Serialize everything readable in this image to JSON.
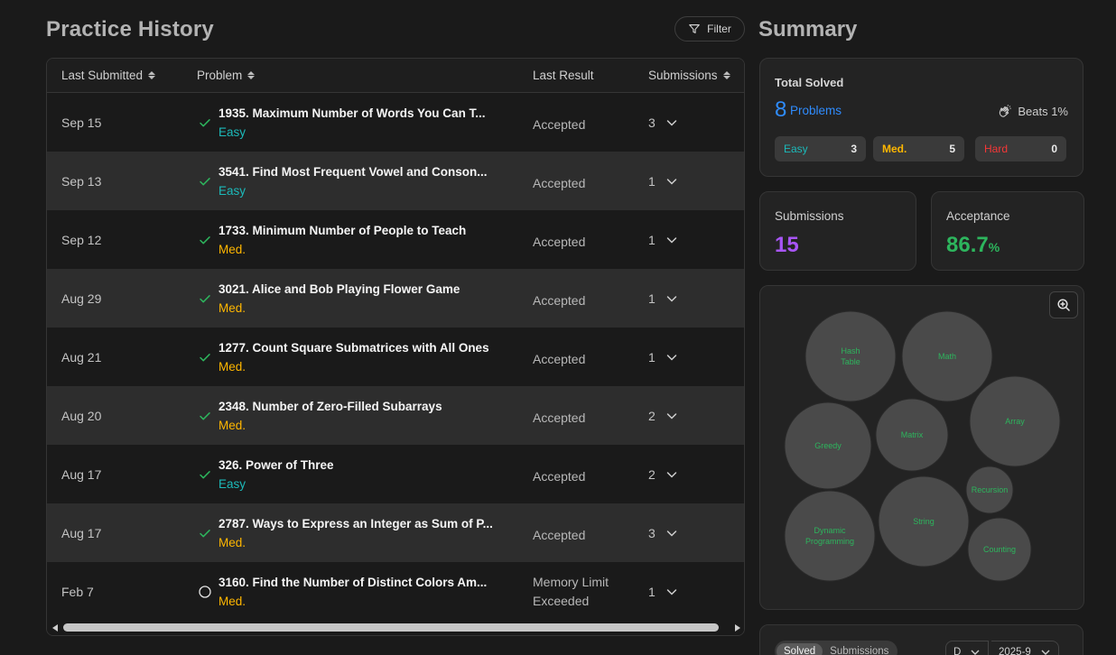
{
  "left": {
    "title": "Practice History",
    "filter_label": "Filter",
    "columns": {
      "c1": "Last Submitted",
      "c2": "Problem",
      "c3": "Last Result",
      "c4": "Submissions"
    },
    "rows": [
      {
        "date": "Sep 15",
        "name": "1935. Maximum Number of Words You Can T...",
        "difficulty": "Easy",
        "diff_class": "easy",
        "status": "check",
        "result": "Accepted",
        "subs": "3"
      },
      {
        "date": "Sep 13",
        "name": "3541. Find Most Frequent Vowel and Conson...",
        "difficulty": "Easy",
        "diff_class": "easy",
        "status": "check",
        "result": "Accepted",
        "subs": "1"
      },
      {
        "date": "Sep 12",
        "name": "1733. Minimum Number of People to Teach",
        "difficulty": "Med.",
        "diff_class": "med",
        "status": "check",
        "result": "Accepted",
        "subs": "1"
      },
      {
        "date": "Aug 29",
        "name": "3021. Alice and Bob Playing Flower Game",
        "difficulty": "Med.",
        "diff_class": "med",
        "status": "check",
        "result": "Accepted",
        "subs": "1"
      },
      {
        "date": "Aug 21",
        "name": "1277. Count Square Submatrices with All Ones",
        "difficulty": "Med.",
        "diff_class": "med",
        "status": "check",
        "result": "Accepted",
        "subs": "1"
      },
      {
        "date": "Aug 20",
        "name": "2348. Number of Zero-Filled Subarrays",
        "difficulty": "Med.",
        "diff_class": "med",
        "status": "check",
        "result": "Accepted",
        "subs": "2"
      },
      {
        "date": "Aug 17",
        "name": "326. Power of Three",
        "difficulty": "Easy",
        "diff_class": "easy",
        "status": "check",
        "result": "Accepted",
        "subs": "2"
      },
      {
        "date": "Aug 17",
        "name": "2787. Ways to Express an Integer as Sum of P...",
        "difficulty": "Med.",
        "diff_class": "med",
        "status": "check",
        "result": "Accepted",
        "subs": "3"
      },
      {
        "date": "Feb 7",
        "name": "3160. Find the Number of Distinct Colors Am...",
        "difficulty": "Med.",
        "diff_class": "med",
        "status": "circle",
        "result": "Memory Limit Exceeded",
        "subs": "1"
      }
    ]
  },
  "summary": {
    "title": "Summary",
    "total_solved_label": "Total Solved",
    "solved_count": "8",
    "solved_unit": "Problems",
    "beats": "Beats 1%",
    "easy_label": "Easy",
    "easy_count": "3",
    "med_label": "Med.",
    "med_count": "5",
    "hard_label": "Hard",
    "hard_count": "0",
    "submissions_label": "Submissions",
    "submissions_value": "15",
    "acceptance_label": "Acceptance",
    "acceptance_value": "86.7",
    "acceptance_unit": "%",
    "topics": [
      "Hash Table",
      "Math",
      "Array",
      "Greedy",
      "Matrix",
      "Recursion",
      "Dynamic Programming",
      "String",
      "Counting"
    ],
    "tabs": {
      "solved": "Solved",
      "submissions": "Submissions"
    },
    "select1": "D",
    "select2": "2025-9"
  },
  "colors": {
    "accent_blue": "#2f8cff",
    "easy": "#1cbaba",
    "medium": "#ffb700",
    "hard": "#f63737",
    "accepted_check": "#2db55d",
    "submissions_purple": "#a855f7",
    "bubble_fill": "#4a4a4a",
    "bubble_text": "#2db55d"
  }
}
